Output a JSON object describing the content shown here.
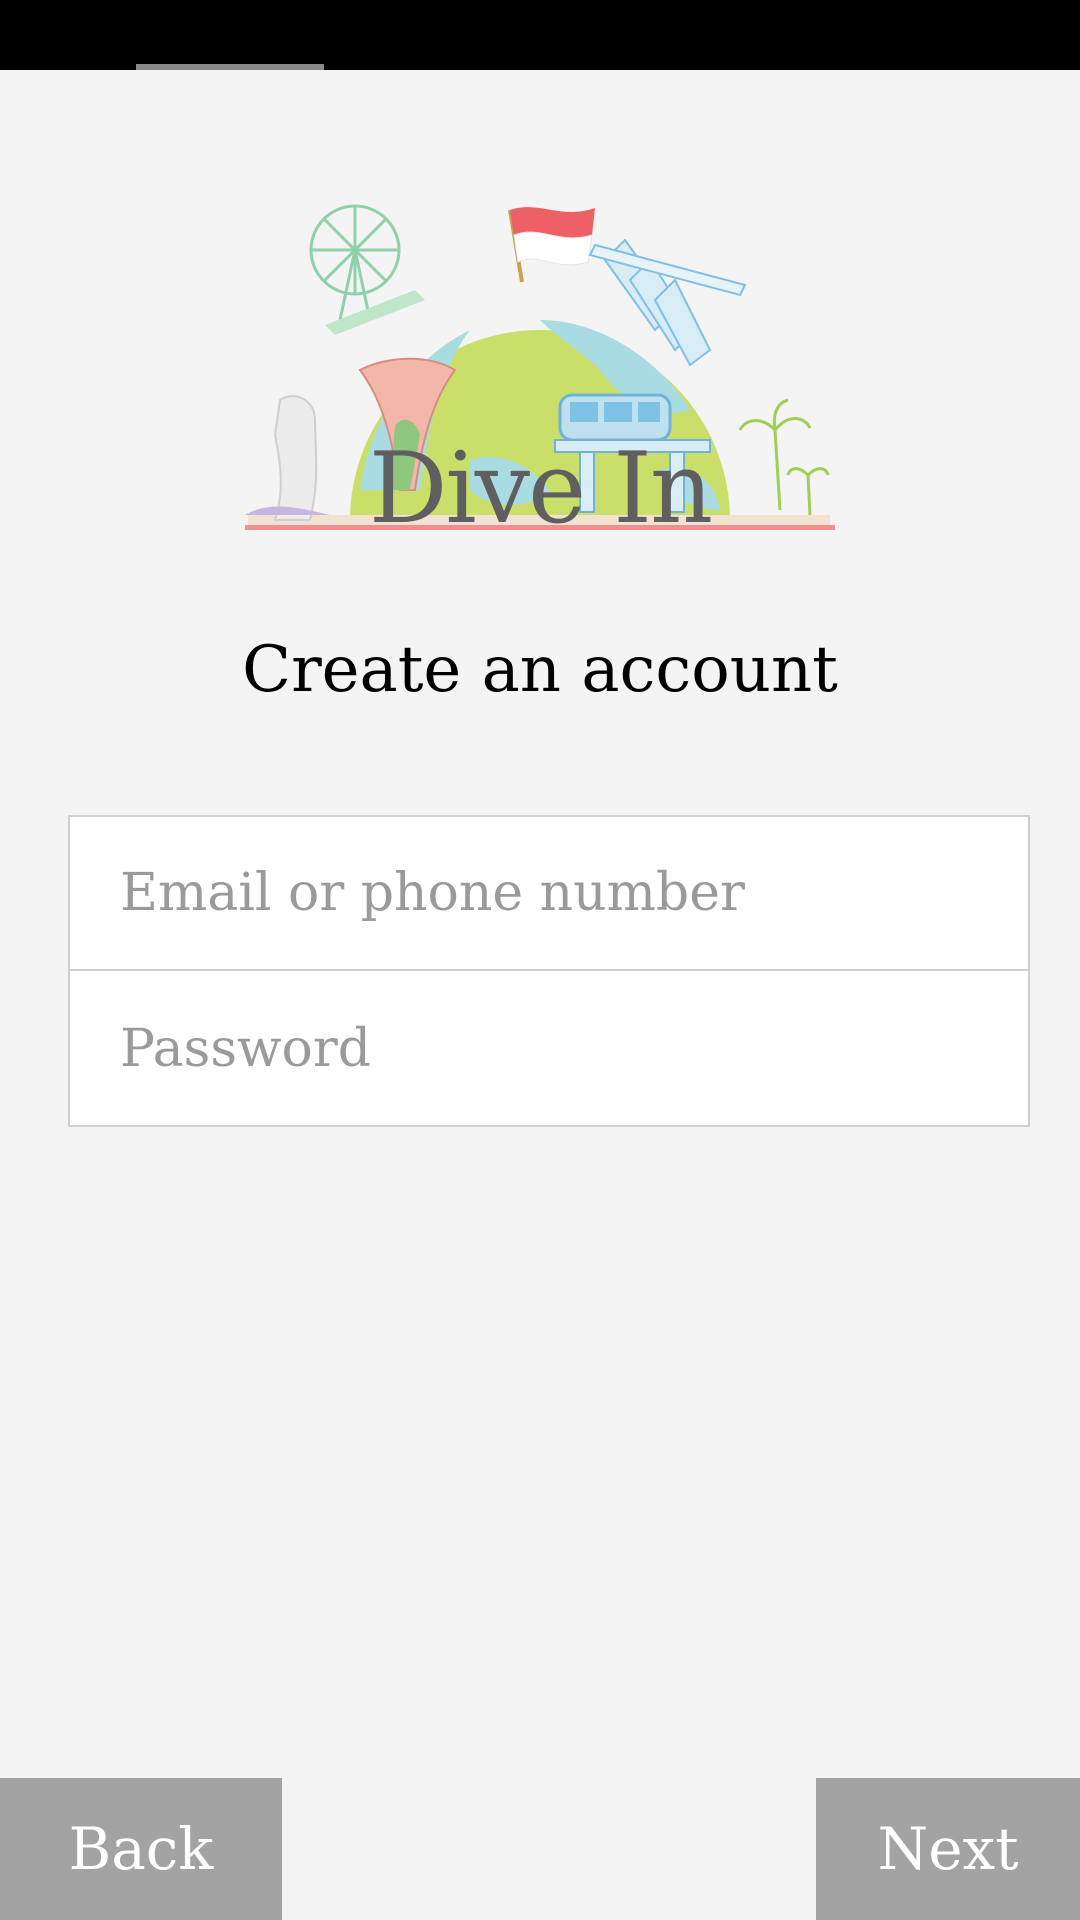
{
  "app": {
    "logo_text": "Dive In"
  },
  "screen": {
    "title": "Create an account"
  },
  "form": {
    "email_placeholder": "Email or phone number",
    "email_value": "",
    "password_placeholder": "Password",
    "password_value": ""
  },
  "footer": {
    "back_label": "Back",
    "next_label": "Next"
  },
  "colors": {
    "background": "#f4f4f4",
    "button": "#a3a3a3",
    "status_bar": "#000000"
  }
}
